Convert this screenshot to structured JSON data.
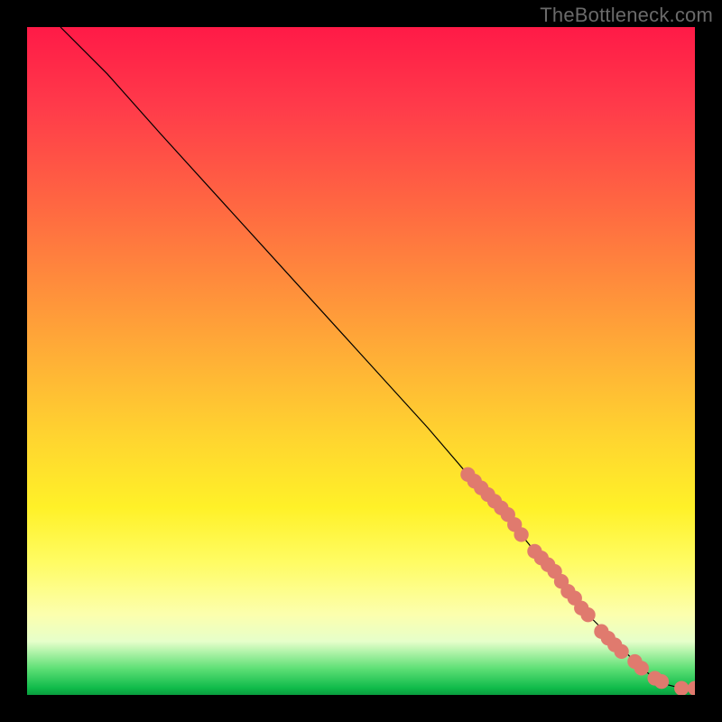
{
  "watermark": "TheBottleneck.com",
  "chart_data": {
    "type": "line",
    "title": "",
    "xlabel": "",
    "ylabel": "",
    "xlim": [
      0,
      100
    ],
    "ylim": [
      0,
      100
    ],
    "grid": false,
    "legend": false,
    "series": [
      {
        "name": "curve",
        "style": "line",
        "color": "#000000",
        "x": [
          5,
          8,
          12,
          20,
          30,
          40,
          50,
          60,
          66,
          70,
          74,
          78,
          82,
          86,
          90,
          92,
          94,
          96,
          98,
          100
        ],
        "y": [
          100,
          97,
          93,
          84,
          73,
          62,
          51,
          40,
          33,
          29,
          24,
          19,
          14,
          10,
          6,
          4,
          2.5,
          1.5,
          1,
          1
        ]
      },
      {
        "name": "highlighted-points",
        "style": "scatter",
        "color": "#e07a6e",
        "x": [
          66,
          67,
          68,
          69,
          70,
          71,
          72,
          73,
          74,
          76,
          77,
          78,
          79,
          80,
          81,
          82,
          83,
          84,
          86,
          87,
          88,
          89,
          91,
          92,
          94,
          95,
          98,
          100
        ],
        "y": [
          33,
          32,
          31,
          30,
          29,
          28,
          27,
          25.5,
          24,
          21.5,
          20.5,
          19.5,
          18.5,
          17,
          15.5,
          14.5,
          13,
          12,
          9.5,
          8.5,
          7.5,
          6.5,
          5,
          4,
          2.5,
          2,
          1,
          1
        ]
      }
    ]
  }
}
